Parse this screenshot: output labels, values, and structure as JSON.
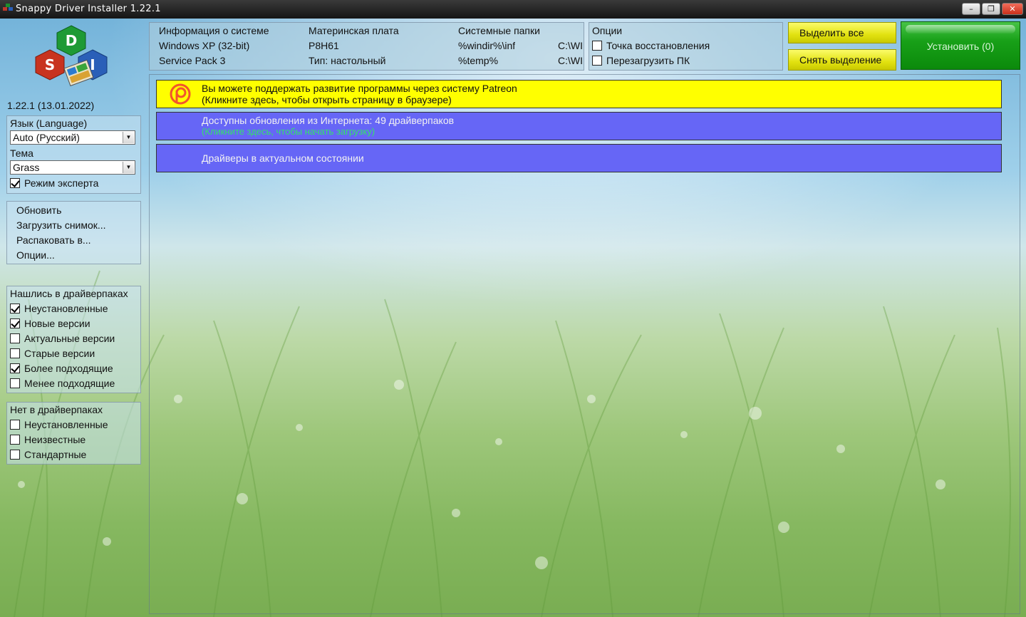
{
  "window": {
    "title": "Snappy Driver Installer 1.22.1",
    "controls": [
      "–",
      "❐",
      "✕"
    ]
  },
  "logo": {
    "letters": [
      "D",
      "S",
      "I"
    ]
  },
  "version_label": "1.22.1 (13.01.2022)",
  "settings": {
    "language_label": "Язык (Language)",
    "language_value": "Auto (Русский)",
    "theme_label": "Тема",
    "theme_value": "Grass",
    "expert_mode_label": "Режим эксперта",
    "expert_mode_checked": true
  },
  "actions": {
    "refresh": "Обновить",
    "load_snapshot": "Загрузить снимок...",
    "extract_to": "Распаковать в...",
    "options": "Опции..."
  },
  "found_in_packs": {
    "header": "Нашлись в драйверпаках",
    "items": [
      {
        "label": "Неустановленные",
        "checked": true
      },
      {
        "label": "Новые версии",
        "checked": true
      },
      {
        "label": "Актуальные версии",
        "checked": false
      },
      {
        "label": "Старые версии",
        "checked": false
      },
      {
        "label": "Более подходящие",
        "checked": true
      },
      {
        "label": "Менее подходящие",
        "checked": false
      }
    ]
  },
  "not_in_packs": {
    "header": "Нет в драйверпаках",
    "items": [
      {
        "label": "Неустановленные",
        "checked": false
      },
      {
        "label": "Неизвестные",
        "checked": false
      },
      {
        "label": "Стандартные",
        "checked": false
      }
    ]
  },
  "system_info": {
    "col1": [
      "Информация о системе",
      "Windows XP (32-bit)",
      "Service Pack 3"
    ],
    "col2": [
      "Материнская плата",
      "P8H61",
      "Тип: настольный"
    ],
    "col3": [
      "Системные папки",
      "%windir%\\inf",
      "%temp%"
    ],
    "col4": [
      "",
      "C:\\WI",
      "C:\\WI"
    ]
  },
  "options_panel": {
    "header": "Опции",
    "restore_point": "Точка восстановления",
    "reboot": "Перезагрузить ПК"
  },
  "buttons": {
    "select_all": "Выделить все",
    "deselect": "Снять выделение",
    "install": "Установить (0)"
  },
  "banners": {
    "patreon_line1": "Вы можете поддержать развитие программы через систему Patreon",
    "patreon_line2": "(Кликните здесь, чтобы открыть страницу в браузере)",
    "updates_line1": "Доступны обновления из Интернета: 49 драйверпаков",
    "updates_line2": "(Кликните здесь, чтобы начать загрузку)",
    "actual_line1": "Драйверы в актуальном состоянии"
  },
  "colors": {
    "patreon_bg": "#ffff00",
    "banner_blue": "#6666f6",
    "updates_link": "#34e26a",
    "install_green": "#18a018",
    "yellow_button": "#e2e210"
  }
}
